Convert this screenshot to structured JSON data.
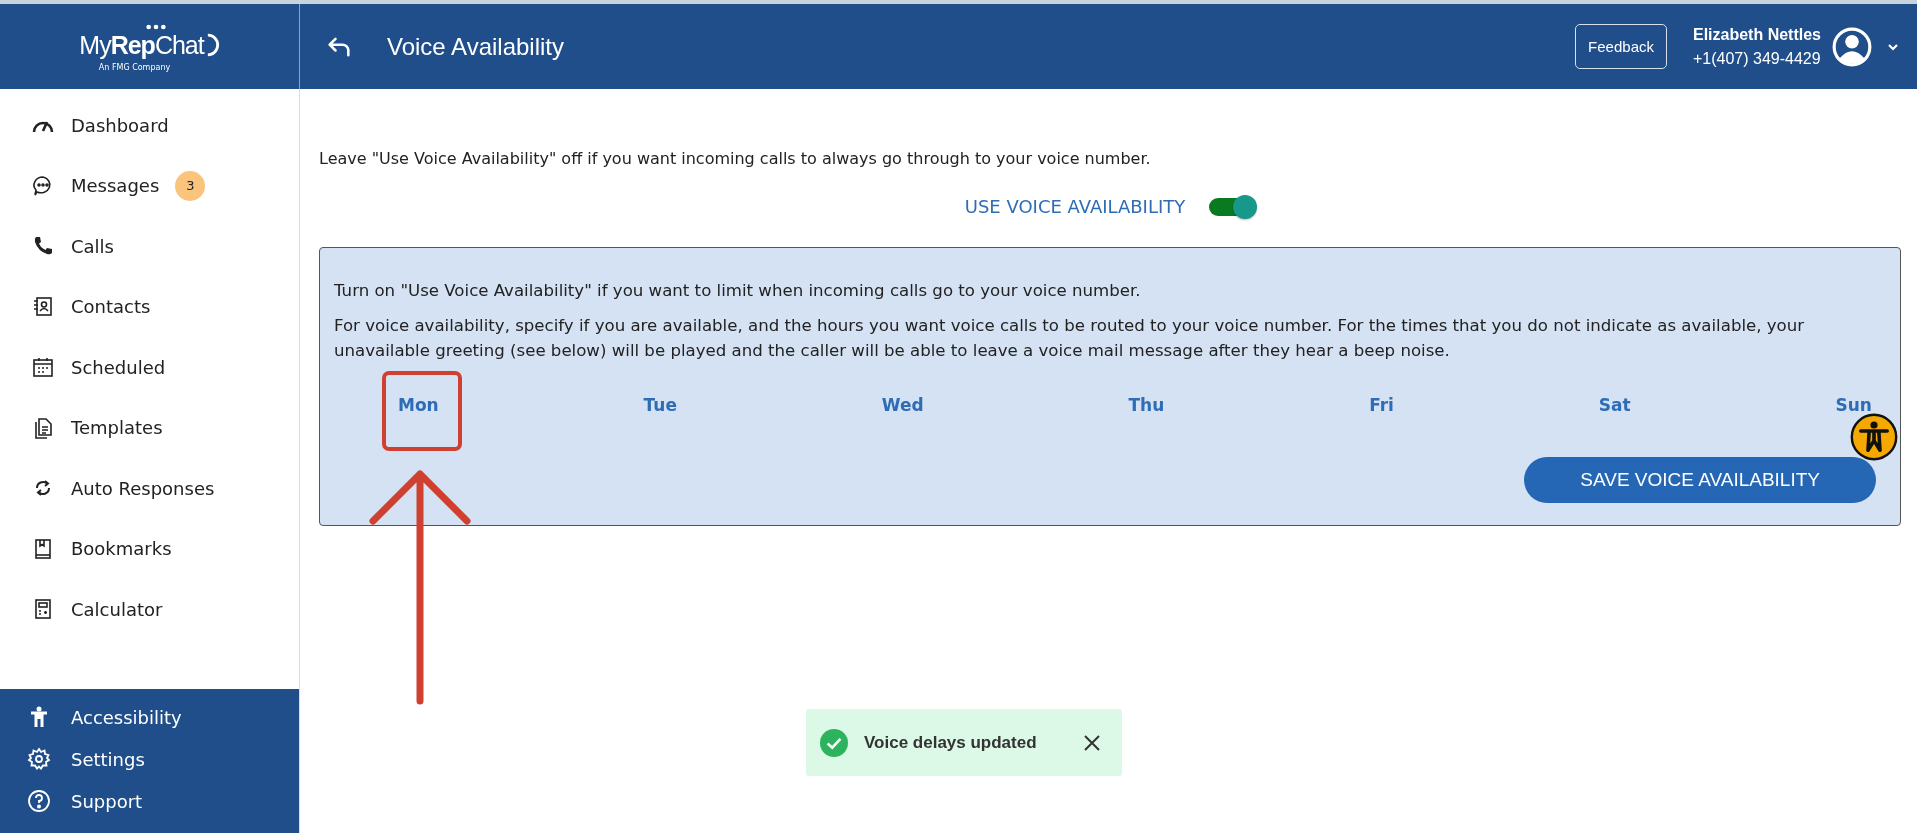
{
  "brand": {
    "name_light_1": "My",
    "name_bold": "Rep",
    "name_light_2": "Chat",
    "tagline": "An FMG Company"
  },
  "header": {
    "title": "Voice Availability",
    "feedback": "Feedback",
    "user_name": "Elizabeth Nettles",
    "user_phone": "+1(407) 349-4429"
  },
  "sidebar": {
    "items": [
      {
        "label": "Dashboard",
        "kind": "gauge"
      },
      {
        "label": "Messages",
        "kind": "chat",
        "badge": "3"
      },
      {
        "label": "Calls",
        "kind": "phone"
      },
      {
        "label": "Contacts",
        "kind": "contacts"
      },
      {
        "label": "Scheduled",
        "kind": "calendar"
      },
      {
        "label": "Templates",
        "kind": "document"
      },
      {
        "label": "Auto Responses",
        "kind": "refresh"
      },
      {
        "label": "Bookmarks",
        "kind": "bookmark"
      },
      {
        "label": "Calculator",
        "kind": "calculator"
      }
    ],
    "footer_items": [
      {
        "label": "Accessibility",
        "kind": "person"
      },
      {
        "label": "Settings",
        "kind": "gear"
      },
      {
        "label": "Support",
        "kind": "help"
      }
    ]
  },
  "main": {
    "intro": "Leave \"Use Voice Availability\" off if you want incoming calls to always go through to your voice number.",
    "toggle": {
      "label": "USE VOICE AVAILABILITY",
      "on": true
    },
    "panel": {
      "paragraphs": [
        "Turn on \"Use Voice Availability\" if you want to limit when incoming calls go to your voice number.",
        "For voice availability, specify if you are available, and the hours you want voice calls to be routed to your voice number. For the times that you do not indicate as available, your unavailable greeting (see below) will be played and the caller will be able to leave a voice mail message after they hear a beep noise."
      ],
      "days": [
        "Mon",
        "Tue",
        "Wed",
        "Thu",
        "Fri",
        "Sat",
        "Sun"
      ],
      "save_button": "SAVE VOICE AVAILABILITY"
    }
  },
  "toast": {
    "message": "Voice delays updated"
  }
}
